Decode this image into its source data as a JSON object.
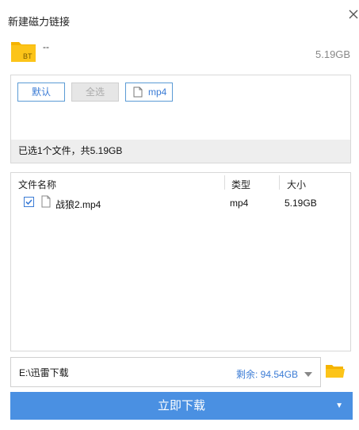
{
  "dialog": {
    "title": "新建磁力链接"
  },
  "file": {
    "icon_label": "BT",
    "name": "--",
    "size": "5.19GB"
  },
  "filter": {
    "buttons": [
      {
        "label": "默认",
        "state": "normal"
      },
      {
        "label": "全选",
        "state": "disabled"
      },
      {
        "label": "mp4",
        "state": "normal",
        "icon": "document-icon"
      }
    ],
    "summary": "已选1个文件，共5.19GB"
  },
  "file_list": {
    "columns": [
      "文件名称",
      "类型",
      "大小"
    ],
    "rows": [
      {
        "checked": true,
        "name": "战狼2.mp4",
        "type": "mp4",
        "size": "5.19GB"
      }
    ]
  },
  "save": {
    "path": "E:\\迅雷下载",
    "free_space": "剩余: 94.54GB"
  },
  "primary": {
    "label": "立即下载"
  },
  "colors": {
    "accent": "#4a90e2",
    "link": "#3a7bd5",
    "folder": "#f5b400"
  }
}
